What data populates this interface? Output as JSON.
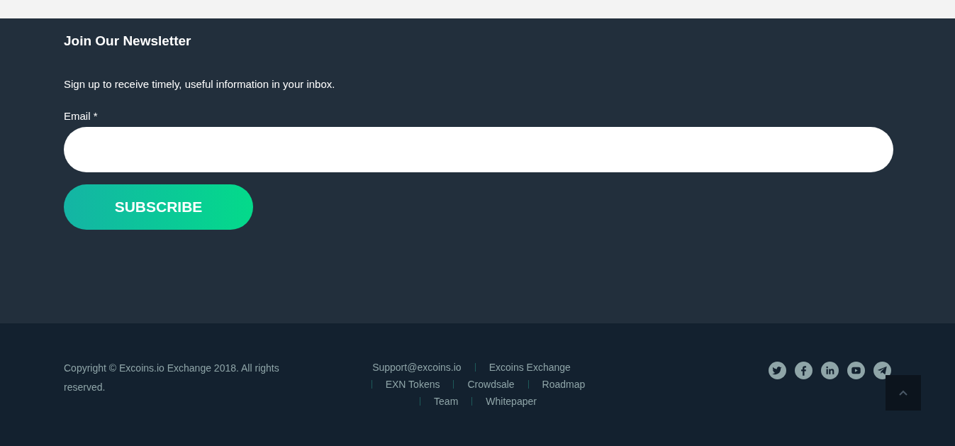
{
  "newsletter": {
    "title": "Join Our Newsletter",
    "description": "Sign up to receive timely, useful information in your inbox.",
    "email_label": "Email *",
    "subscribe_button": "SUBSCRIBE"
  },
  "footer": {
    "copyright": "Copyright © Excoins.io Exchange 2018. All rights reserved.",
    "link_rows": [
      [
        "Support@excoins.io",
        "Excoins Exchange"
      ],
      [
        "EXN Tokens",
        "Crowdsale",
        "Roadmap"
      ],
      [
        "Team",
        "Whitepaper"
      ]
    ]
  }
}
